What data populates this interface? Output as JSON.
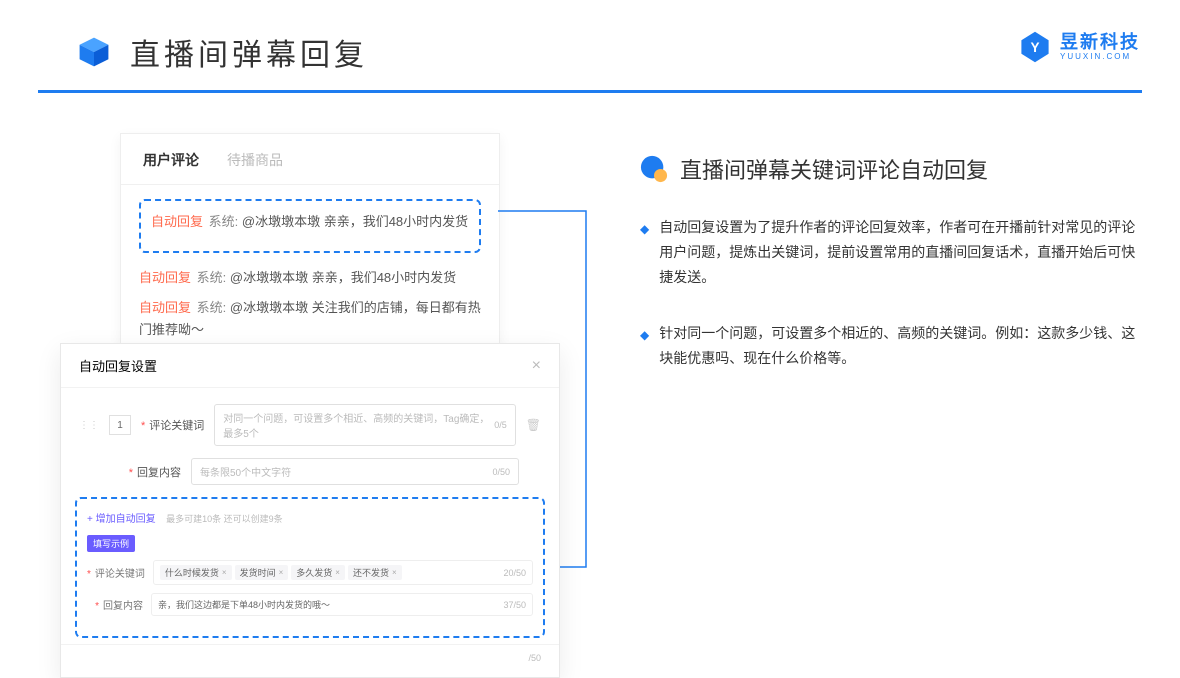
{
  "header": {
    "title": "直播间弹幕回复",
    "brand_cn": "昱新科技",
    "brand_en": "YUUXIN.COM"
  },
  "commentPanel": {
    "tabs": {
      "active": "用户评论",
      "inactive": "待播商品"
    },
    "highlighted": {
      "tag": "自动回复",
      "sys": "系统:",
      "text": "@冰墩墩本墩 亲亲，我们48小时内发货"
    },
    "items": [
      {
        "tag": "自动回复",
        "sys": "系统:",
        "text": "@冰墩墩本墩 亲亲，我们48小时内发货"
      },
      {
        "tag": "自动回复",
        "sys": "系统:",
        "text": "@冰墩墩本墩 关注我们的店铺，每日都有热门推荐呦～"
      }
    ]
  },
  "settings": {
    "title": "自动回复设置",
    "index": "1",
    "keywordLabel": "评论关键词",
    "keywordPlaceholder": "对同一个问题，可设置多个相近、高频的关键词，Tag确定，最多5个",
    "keywordCounter": "0/5",
    "contentLabel": "回复内容",
    "contentPlaceholder": "每条限50个中文字符",
    "contentCounter": "0/50",
    "addLink": "+ 增加自动回复",
    "addHint": "最多可建10条 还可以创建9条",
    "exampleBadge": "填写示例",
    "exKeywordLabel": "评论关键词",
    "exTags": [
      "什么时候发货",
      "发货时间",
      "多久发货",
      "还不发货"
    ],
    "exKeywordCounter": "20/50",
    "exContentLabel": "回复内容",
    "exContentText": "亲，我们这边都是下单48小时内发货的哦～",
    "exContentCounter": "37/50",
    "bottomCounter": "/50"
  },
  "right": {
    "title": "直播间弹幕关键词评论自动回复",
    "bullets": [
      "自动回复设置为了提升作者的评论回复效率，作者可在开播前针对常见的评论用户问题，提炼出关键词，提前设置常用的直播间回复话术，直播开始后可快捷发送。",
      "针对同一个问题，可设置多个相近的、高频的关键词。例如：这款多少钱、这块能优惠吗、现在什么价格等。"
    ]
  }
}
